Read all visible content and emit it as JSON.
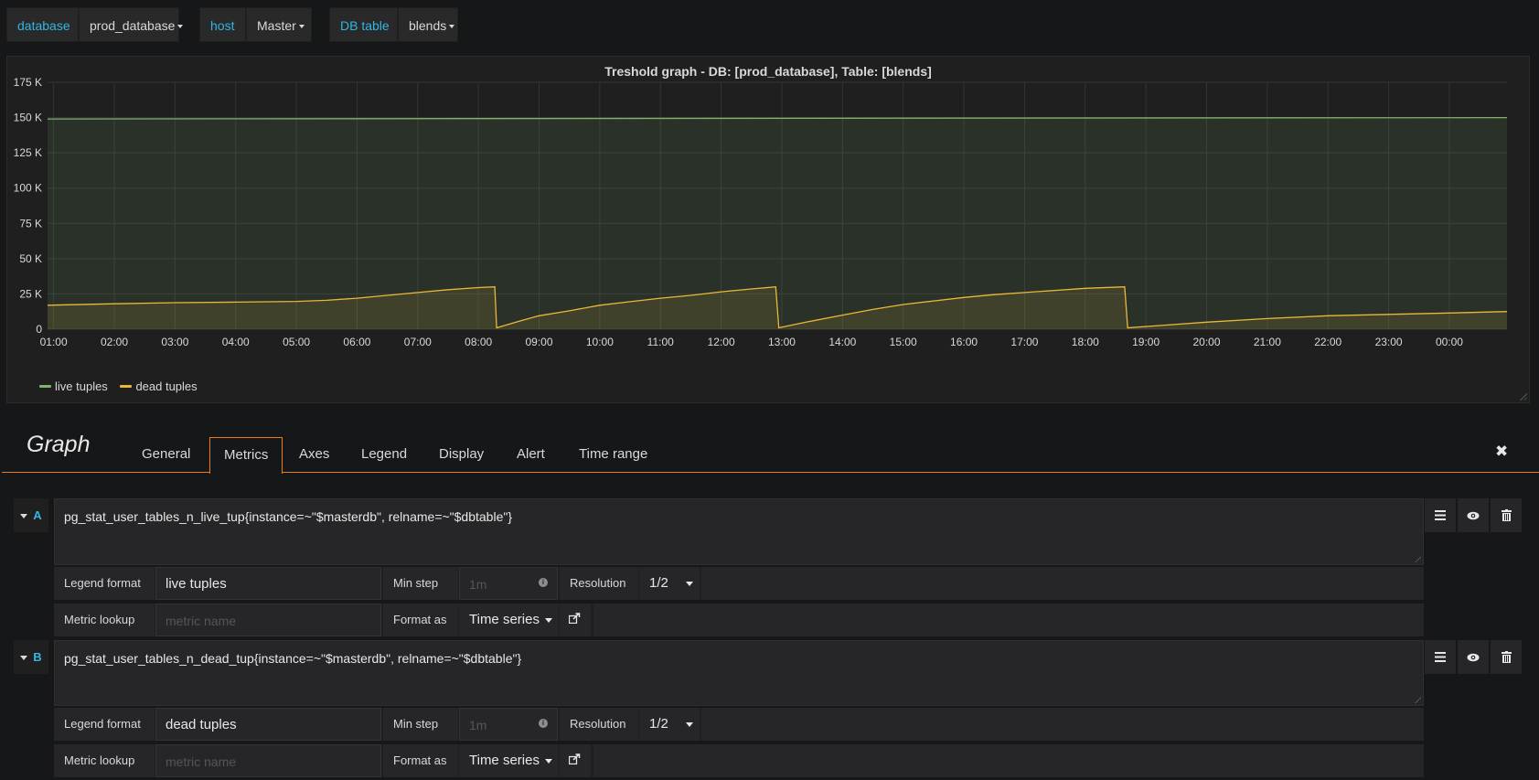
{
  "variables": [
    {
      "label": "database",
      "value": "prod_database"
    },
    {
      "label": "host",
      "value": "Master"
    },
    {
      "label": "DB table",
      "value": "blends"
    }
  ],
  "panel": {
    "title": "Treshold graph - DB: [prod_database], Table: [blends]"
  },
  "chart_data": {
    "type": "area",
    "title": "Treshold graph - DB: [prod_database], Table: [blends]",
    "x_ticks": [
      "01:00",
      "02:00",
      "03:00",
      "04:00",
      "05:00",
      "06:00",
      "07:00",
      "08:00",
      "09:00",
      "10:00",
      "11:00",
      "12:00",
      "13:00",
      "14:00",
      "15:00",
      "16:00",
      "17:00",
      "18:00",
      "19:00",
      "20:00",
      "21:00",
      "22:00",
      "23:00",
      "00:00"
    ],
    "y_ticks": [
      "0",
      "25 K",
      "50 K",
      "75 K",
      "100 K",
      "125 K",
      "150 K",
      "175 K"
    ],
    "ylim": [
      0,
      175000
    ],
    "xlim_hours": [
      0.9,
      24.95
    ],
    "grid": true,
    "legend_position": "bottom-left",
    "series": [
      {
        "name": "live tuples",
        "color": "#7eb26d",
        "x": [
          0.9,
          24.95
        ],
        "values": [
          149000,
          150000
        ]
      },
      {
        "name": "dead tuples",
        "color": "#eab839",
        "x": [
          0.9,
          2.0,
          3.0,
          4.0,
          5.0,
          5.5,
          6.0,
          6.5,
          7.0,
          7.5,
          8.0,
          8.27,
          8.3,
          8.7,
          9.0,
          9.5,
          10.0,
          10.5,
          11.0,
          11.5,
          12.0,
          12.5,
          12.9,
          12.95,
          13.4,
          14.0,
          14.5,
          15.0,
          15.5,
          16.0,
          16.5,
          17.0,
          17.5,
          18.0,
          18.65,
          18.7,
          19.2,
          20.0,
          21.0,
          22.0,
          23.0,
          24.0,
          24.95
        ],
        "values": [
          17000,
          18000,
          18800,
          19200,
          19700,
          20500,
          22000,
          24000,
          26000,
          28000,
          29500,
          30000,
          1000,
          6000,
          9500,
          13000,
          17000,
          19500,
          22000,
          24000,
          26500,
          28500,
          30000,
          1000,
          5000,
          10000,
          14000,
          17500,
          20000,
          22500,
          24500,
          26000,
          27500,
          29000,
          30000,
          1000,
          2500,
          5000,
          7500,
          9500,
          10500,
          11500,
          12500
        ]
      }
    ]
  },
  "legend": [
    {
      "name": "live tuples",
      "color": "#7eb26d"
    },
    {
      "name": "dead tuples",
      "color": "#eab839"
    }
  ],
  "editor": {
    "title": "Graph",
    "tabs": [
      "General",
      "Metrics",
      "Axes",
      "Legend",
      "Display",
      "Alert",
      "Time range"
    ],
    "active_tab": "Metrics"
  },
  "queries": [
    {
      "letter": "A",
      "expr": "pg_stat_user_tables_n_live_tup{instance=~\"$masterdb\", relname=~\"$dbtable\"}",
      "legend_format_label": "Legend format",
      "legend_format_value": "live tuples",
      "min_step_label": "Min step",
      "min_step_placeholder": "1m",
      "resolution_label": "Resolution",
      "resolution_value": "1/2",
      "metric_lookup_label": "Metric lookup",
      "metric_lookup_placeholder": "metric name",
      "format_as_label": "Format as",
      "format_as_value": "Time series"
    },
    {
      "letter": "B",
      "expr": "pg_stat_user_tables_n_dead_tup{instance=~\"$masterdb\", relname=~\"$dbtable\"}",
      "legend_format_label": "Legend format",
      "legend_format_value": "dead tuples",
      "min_step_label": "Min step",
      "min_step_placeholder": "1m",
      "resolution_label": "Resolution",
      "resolution_value": "1/2",
      "metric_lookup_label": "Metric lookup",
      "metric_lookup_placeholder": "metric name",
      "format_as_label": "Format as",
      "format_as_value": "Time series"
    }
  ]
}
